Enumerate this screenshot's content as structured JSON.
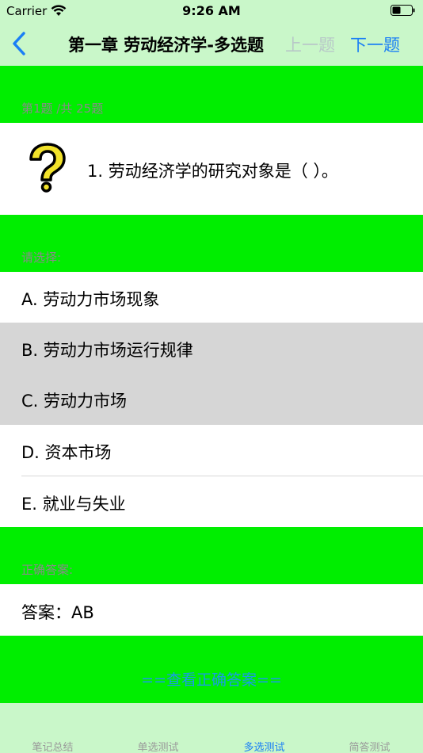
{
  "status": {
    "carrier": "Carrier",
    "time": "9:26 AM"
  },
  "nav": {
    "title": "第一章 劳动经济学-多选题",
    "prev_label": "上一题",
    "next_label": "下一题"
  },
  "progress": {
    "label": "第1题 /共 25题"
  },
  "question": {
    "text": "1.  劳动经济学的研究对象是（  ）。"
  },
  "choose": {
    "label": "请选择:"
  },
  "options": [
    {
      "label": "A.  劳动力市场现象",
      "selected": false
    },
    {
      "label": "B.  劳动力市场运行规律",
      "selected": true
    },
    {
      "label": "C.  劳动力市场",
      "selected": true
    },
    {
      "label": "D.  资本市场",
      "selected": false
    },
    {
      "label": "E.  就业与失业",
      "selected": false
    }
  ],
  "answer": {
    "section_label": "正确答案:",
    "text": "答案：AB",
    "show_button": "==查看正确答案=="
  },
  "tabs": [
    {
      "label": "笔记总结",
      "active": false
    },
    {
      "label": "单选测试",
      "active": false
    },
    {
      "label": "多选测试",
      "active": true
    },
    {
      "label": "简答测试",
      "active": false
    }
  ],
  "colors": {
    "accent": "#1a7ff5",
    "band": "#00ee00",
    "background": "#c9f7c9",
    "selected": "#d6d6d6"
  }
}
